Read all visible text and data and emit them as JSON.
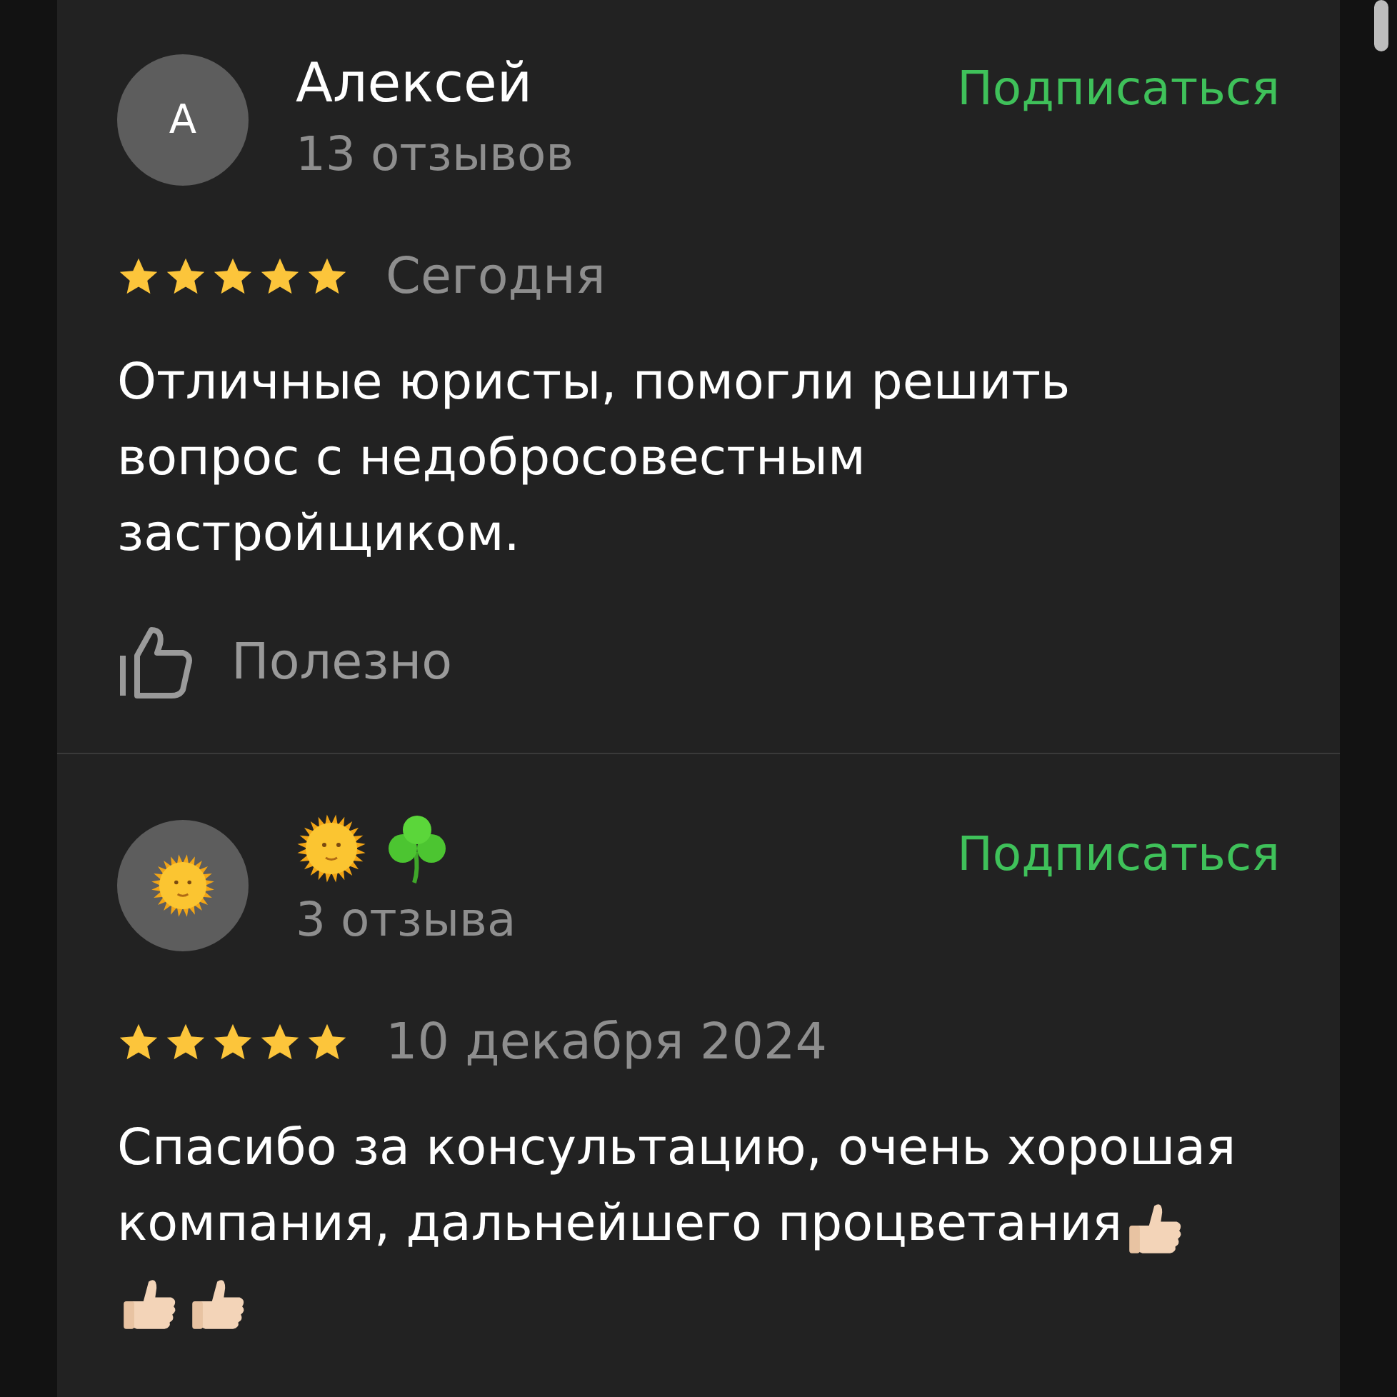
{
  "reviews": [
    {
      "avatar": {
        "kind": "letter",
        "letter": "А"
      },
      "name": [
        {
          "kind": "text",
          "text": "Алексей"
        }
      ],
      "review_count": "13 отзывов",
      "subscribe": "Подписаться",
      "stars": 5,
      "date": "Сегодня",
      "text": "Отличные юристы, помогли решить вопрос с недобросовестным застройщиком.",
      "helpful": "Полезно"
    },
    {
      "avatar": {
        "kind": "sun"
      },
      "name": [
        {
          "kind": "sun"
        },
        {
          "kind": "clover"
        }
      ],
      "review_count": "3 отзыва",
      "subscribe": "Подписаться",
      "stars": 5,
      "date": "10 декабря 2024",
      "text": "Спасибо за консультацию, очень хорошая компания, дальнейшего процветания",
      "trailing_icons": [
        {
          "kind": "thumbs_up"
        },
        {
          "kind": "thumbs_up"
        },
        {
          "kind": "thumbs_up"
        }
      ]
    }
  ]
}
